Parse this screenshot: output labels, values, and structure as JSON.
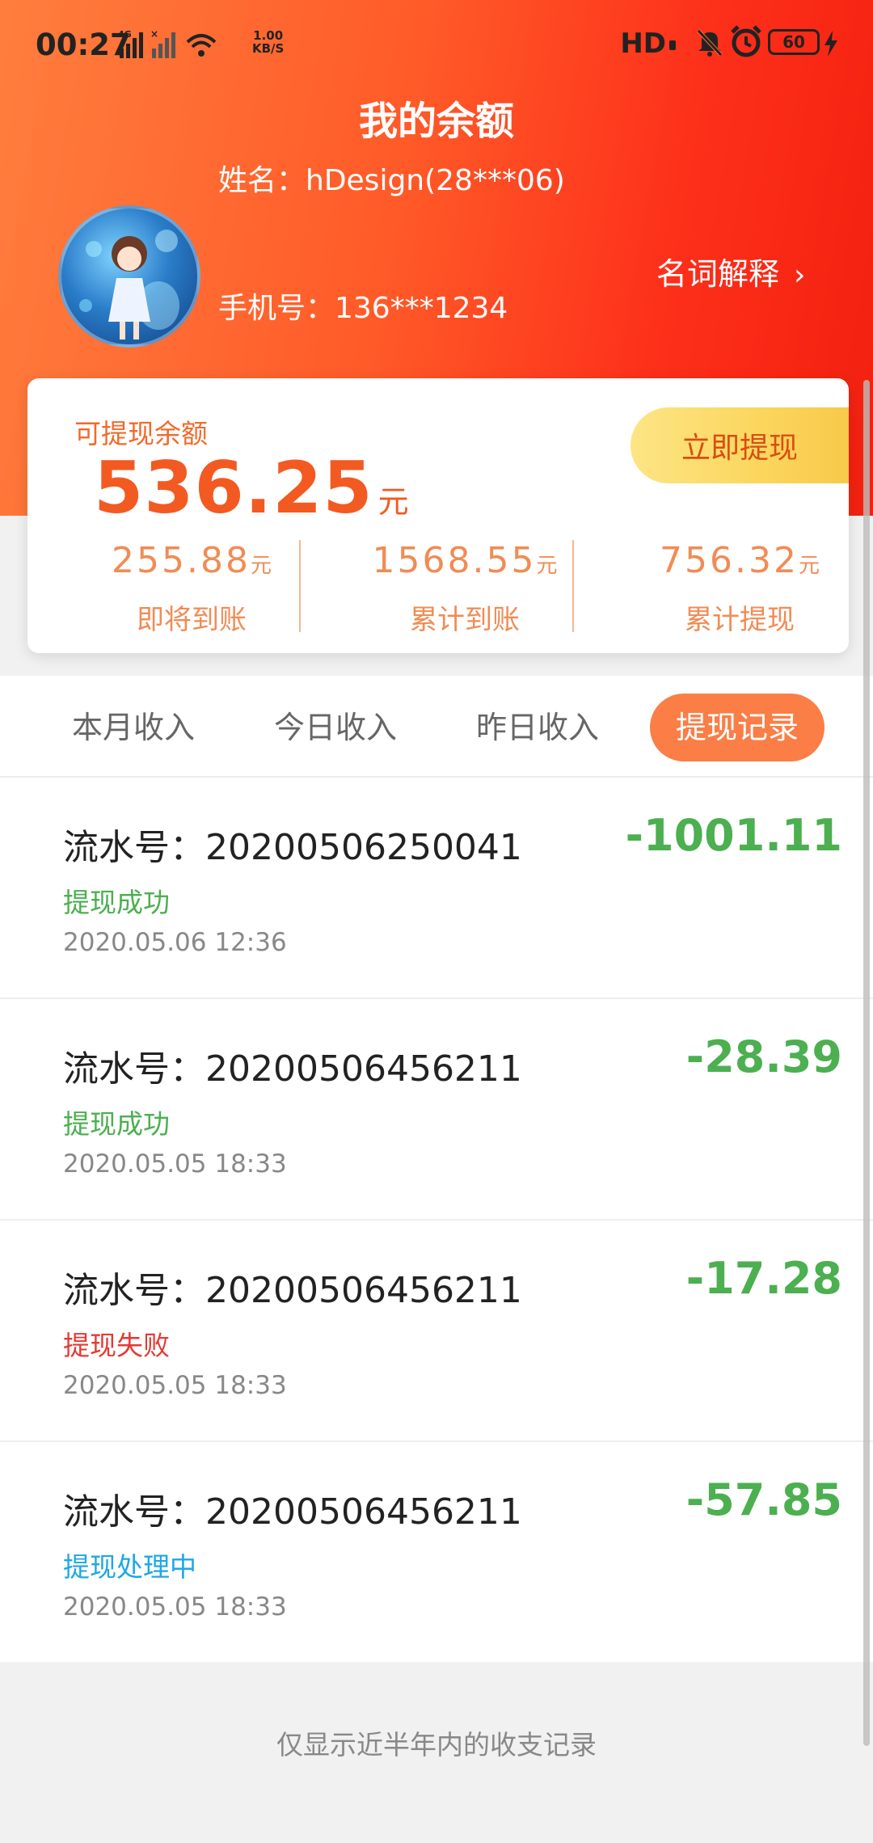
{
  "status_bar": {
    "time": "00:27",
    "speed": "1.00",
    "speed_unit": "KB/S",
    "hd": "HD",
    "battery": "60"
  },
  "header": {
    "title": "我的余额"
  },
  "profile": {
    "name_line": "姓名：hDesign(28***06)",
    "phone_line": "手机号：136***1234",
    "glossary_label": "名词解释"
  },
  "balance": {
    "label": "可提现余额",
    "amount": "536.25",
    "unit": "元",
    "withdraw_button": "立即提现",
    "stats": [
      {
        "value": "255.88",
        "unit": "元",
        "label": "即将到账"
      },
      {
        "value": "1568.55",
        "unit": "元",
        "label": "累计到账"
      },
      {
        "value": "756.32",
        "unit": "元",
        "label": "累计提现"
      }
    ]
  },
  "tabs": [
    {
      "label": "本月收入",
      "active": false
    },
    {
      "label": "今日收入",
      "active": false
    },
    {
      "label": "昨日收入",
      "active": false
    },
    {
      "label": "提现记录",
      "active": true
    }
  ],
  "records": [
    {
      "serial": "流水号：20200506250041",
      "status": "提现成功",
      "status_color": "#4caf50",
      "time": "2020.05.06 12:36",
      "amount": "-1001.11"
    },
    {
      "serial": "流水号：20200506456211",
      "status": "提现成功",
      "status_color": "#4caf50",
      "time": "2020.05.05 18:33",
      "amount": "-28.39"
    },
    {
      "serial": "流水号：20200506456211",
      "status": "提现失败",
      "status_color": "#e53935",
      "time": "2020.05.05 18:33",
      "amount": "-17.28"
    },
    {
      "serial": "流水号：20200506456211",
      "status": "提现处理中",
      "status_color": "#1ea7e6",
      "time": "2020.05.05 18:33",
      "amount": "-57.85"
    }
  ],
  "footer_note": "仅显示近半年内的收支记录"
}
